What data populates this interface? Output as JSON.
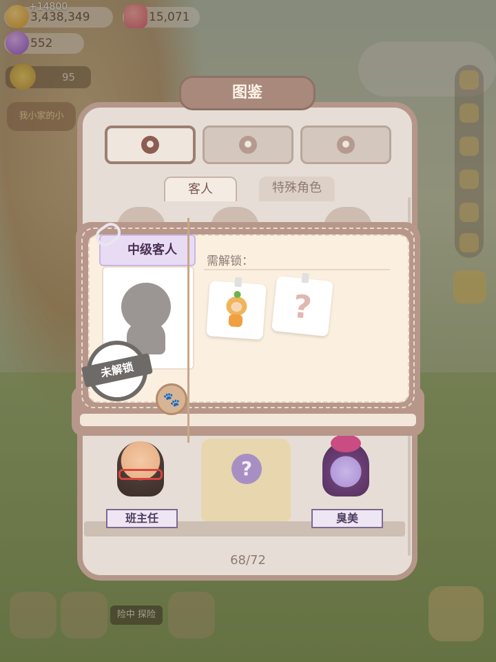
{
  "hud": {
    "coins": "3,438,349",
    "coin_gain": "+14800",
    "hearts": "15,071",
    "gems": "552",
    "level": "95",
    "left_banner": "我小家的小",
    "bottom_label": "险中 探险"
  },
  "encyclopedia": {
    "title": "图鉴",
    "category_tabs": [
      {
        "icon": "person-icon",
        "active": true
      },
      {
        "icon": "building-icon",
        "active": false
      },
      {
        "icon": "badge-icon",
        "active": false
      }
    ],
    "sub_tabs": [
      "客人",
      "特殊角色"
    ],
    "characters": [
      "班主任",
      "臭美"
    ],
    "counter": "68/72"
  },
  "detail_card": {
    "level_tag": "中级客人",
    "unlock_label": "需解锁：",
    "locked_stamp": "未解锁",
    "mystery_symbol": "?",
    "paw_symbol": "🐾"
  },
  "colors": {
    "panel_border": "#b5978a",
    "panel_fill": "#e6ded6",
    "card_fill": "#fbefe0",
    "tag_fill": "#e8dcf4"
  }
}
